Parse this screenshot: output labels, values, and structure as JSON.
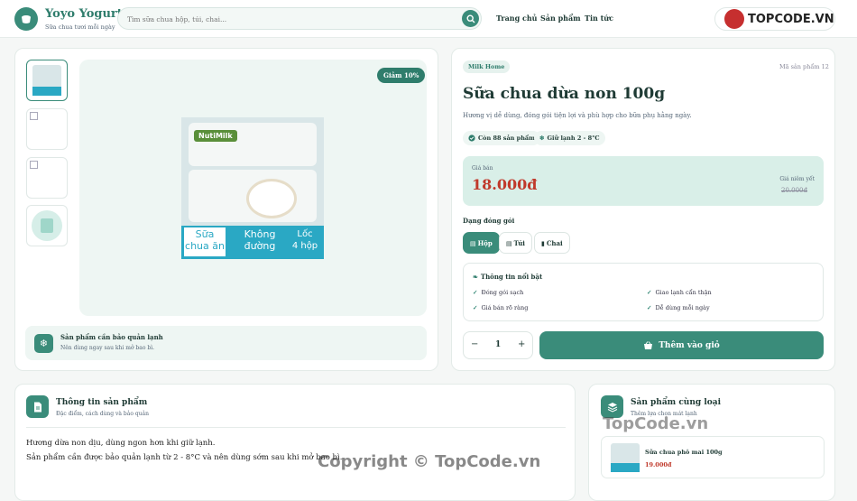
{
  "header": {
    "brand": "Yoyo Yogurt",
    "tagline": "Sữa chua tươi mỗi ngày",
    "search_placeholder": "Tìm sữa chua hộp, túi, chai...",
    "nav": [
      "Trang chủ",
      "Sản phẩm",
      "Tin tức"
    ],
    "watermark_logo": "TOPCODE.VN"
  },
  "gallery": {
    "discount_badge": "Giảm 10%",
    "package_text": {
      "brand": "NutiMilk",
      "line1": "Sữa",
      "line2": "chua ăn",
      "line3": "Không",
      "line4": "đường",
      "line5": "Lốc",
      "line6": "4 hộp"
    }
  },
  "cold_notice": {
    "title": "Sản phẩm cần bảo quản lạnh",
    "desc": "Nên dùng ngay sau khi mở bao bì."
  },
  "product": {
    "brand_pill": "Milk Home",
    "code": "Mã sản phẩm 12",
    "name": "Sữa chua dừa non 100g",
    "desc": "Hương vị dễ dùng, đóng gói tiện lợi và phù hợp cho bữa phụ hằng ngày.",
    "stock": "Còn 88 sản phẩm",
    "storage": "Giữ lạnh 2 - 8°C",
    "price_label": "Giá bán",
    "price": "18.000đ",
    "list_label": "Giá niêm yết",
    "list_price": "20.000đ",
    "format_label": "Dạng đóng gói",
    "formats": [
      "Hộp",
      "Túi",
      "Chai"
    ],
    "features_title": "Thông tin nổi bật",
    "features": [
      "Đóng gói sạch",
      "Giao lạnh cẩn thận",
      "Giá bán rõ ràng",
      "Dễ dùng mỗi ngày"
    ],
    "qty": "1",
    "minus": "−",
    "plus": "+",
    "add_to_cart": "Thêm vào giỏ"
  },
  "info": {
    "title": "Thông tin sản phẩm",
    "subtitle": "Đặc điểm, cách dùng và bảo quản",
    "line1": "Hương dừa non dịu, dùng ngon hơn khi giữ lạnh.",
    "line2": "Sản phẩm cần được bảo quản lạnh từ 2 - 8°C và nên dùng sớm sau khi mở bao bì."
  },
  "related": {
    "title": "Sản phẩm cùng loại",
    "subtitle": "Thêm lựa chọn mát lạnh",
    "item_name": "Sữa chua phô mai 100g",
    "item_price": "19.000đ"
  },
  "watermarks": [
    "TopCode.vn",
    "Copyright © TopCode.vn"
  ]
}
